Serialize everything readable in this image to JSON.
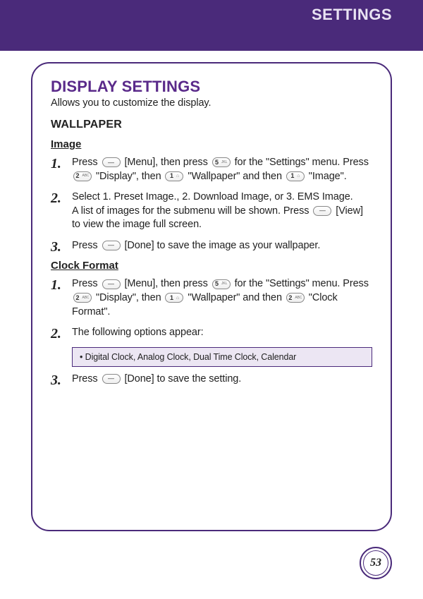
{
  "header": {
    "title": "SETTINGS"
  },
  "section": {
    "title": "DISPLAY SETTINGS",
    "subtitle": "Allows you to customize the display.",
    "wallpaper_h": "WALLPAPER",
    "image_h": "Image",
    "image_steps": {
      "s1": {
        "num": "1.",
        "a": "Press ",
        "b": " [Menu], then press ",
        "c": " for the \"Settings\" menu. Press ",
        "d": " \"Display\", then ",
        "e": " \"Wallpaper\" and then ",
        "f": " \"Image\"."
      },
      "s2": {
        "num": "2.",
        "a": "Select 1. Preset Image., 2. Download Image, or 3. EMS Image.",
        "b": "A list of images for the submenu will be shown.  Press ",
        "c": " [View] to view the image full screen."
      },
      "s3": {
        "num": "3.",
        "a": "Press ",
        "b": " [Done] to save the image as your wallpaper."
      }
    },
    "clock_h": "Clock Format",
    "clock_steps": {
      "s1": {
        "num": "1.",
        "a": "Press ",
        "b": " [Menu], then press ",
        "c": " for the \"Settings\" menu. Press ",
        "d": " \"Display\", then ",
        "e": " \"Wallpaper\" and then ",
        "f": " \"Clock Format\"."
      },
      "s2": {
        "num": "2.",
        "a": "The following options appear:"
      },
      "s3": {
        "num": "3.",
        "a": "Press ",
        "b": " [Done] to save the setting."
      }
    },
    "options_box": "• Digital Clock, Analog Clock, Dual Time Clock, Calendar"
  },
  "page_number": "53"
}
